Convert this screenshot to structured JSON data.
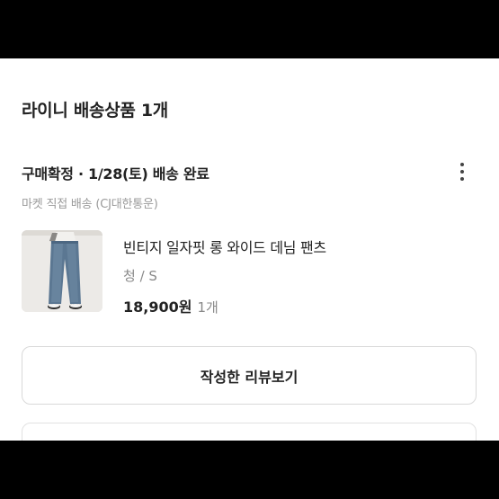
{
  "section": {
    "title": "라이니 배송상품 1개"
  },
  "order": {
    "status": "구매확정 · 1/28(토) 배송 완료",
    "shipping": "마켓 직접 배송 (CJ대한통운)",
    "more_icon": "more-vertical-icon"
  },
  "product": {
    "name": "빈티지 일자핏 롱 와이드 데님 팬츠",
    "option": "청 / S",
    "price": "18,900원",
    "quantity": "1개",
    "thumbnail": "product-photo-denim-pants"
  },
  "actions": {
    "review_button": "작성한 리뷰보기"
  },
  "colors": {
    "page_bg": "#000000",
    "panel_bg": "#ffffff",
    "text_primary": "#222222",
    "text_muted": "#9a9a9a",
    "border": "#d9d9d9"
  }
}
